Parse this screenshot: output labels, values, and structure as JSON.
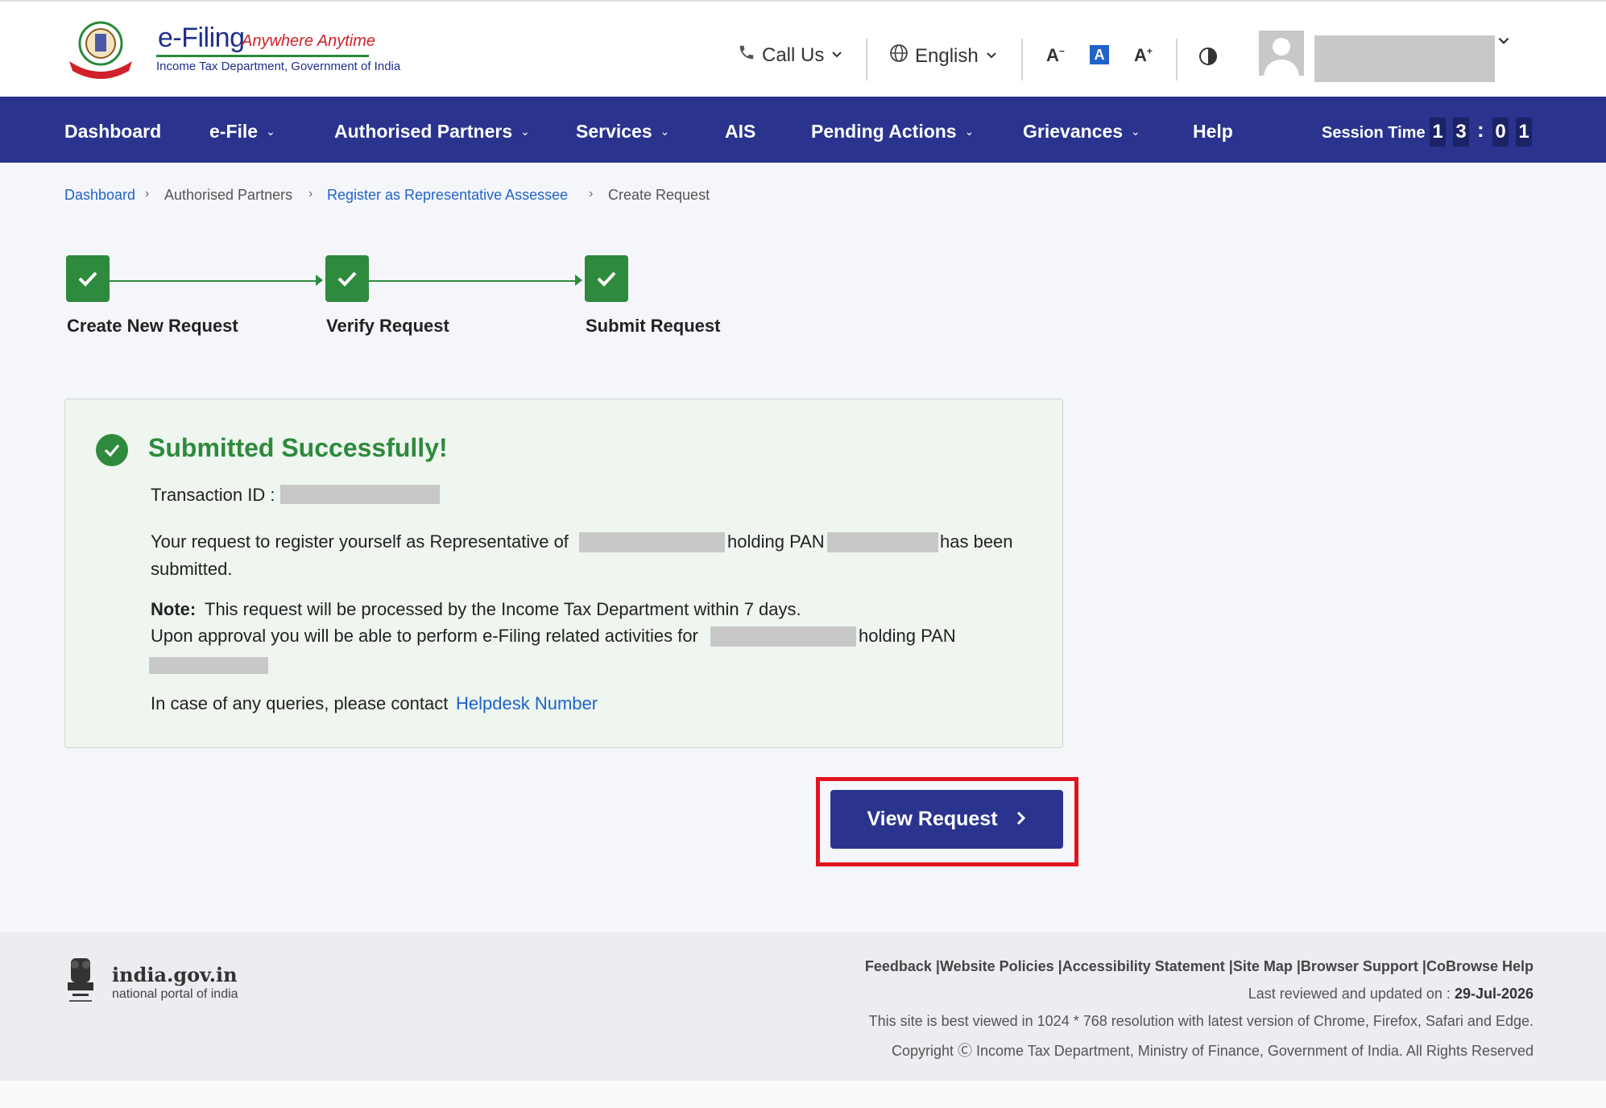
{
  "header": {
    "logo_title": "e-Filing",
    "logo_tagline": "Anywhere Anytime",
    "logo_subtitle": "Income Tax Department, Government of India",
    "call_us": "Call Us",
    "language": "English",
    "contrast_icon": "contrast-icon"
  },
  "nav": {
    "items": [
      "Dashboard",
      "e-File",
      "Authorised Partners",
      "Services",
      "AIS",
      "Pending Actions",
      "Grievances",
      "Help"
    ],
    "session_label": "Session Time",
    "session_digits": [
      "1",
      "3",
      "0",
      "1"
    ],
    "session_separator": ":"
  },
  "breadcrumb": {
    "items": [
      "Dashboard",
      "Authorised Partners",
      "Register as Representative Assessee",
      "Create Request"
    ]
  },
  "stepper": {
    "steps": [
      "Create New Request",
      "Verify Request",
      "Submit Request"
    ]
  },
  "success": {
    "title": "Submitted Successfully!",
    "transaction_label": "Transaction ID :",
    "msg_part1": "Your request to register yourself as Representative of",
    "msg_part2": "holding PAN",
    "msg_part3": "has been",
    "msg_part4": "submitted.",
    "note_label": "Note:",
    "note_text": "This request will be processed by the Income Tax Department within 7 days.",
    "approval_text": "Upon approval you will be able to perform e-Filing related activities for",
    "approval_pan": "holding PAN",
    "queries_text": "In case of any queries, please contact",
    "helpdesk_link": "Helpdesk Number"
  },
  "actions": {
    "view_request": "View Request"
  },
  "footer": {
    "portal_title": "india.gov.in",
    "portal_subtitle": "national portal of india",
    "links": [
      "Feedback",
      "Website Policies",
      "Accessibility Statement",
      "Site Map",
      "Browser Support",
      "CoBrowse Help"
    ],
    "link_separator": " |",
    "last_reviewed_label": "Last reviewed and updated on :",
    "last_reviewed_date": "29-Jul-2026",
    "best_viewed": "This site is best viewed in 1024 * 768 resolution with latest version of Chrome, Firefox, Safari and Edge.",
    "copyright": "Copyright Ⓒ Income Tax Department, Ministry of Finance, Government of India. All Rights Reserved"
  },
  "colors": {
    "nav_bg": "#2a348e",
    "success_green": "#2e8a3c",
    "link_blue": "#1f63c9",
    "highlight_red": "#e0141e"
  }
}
